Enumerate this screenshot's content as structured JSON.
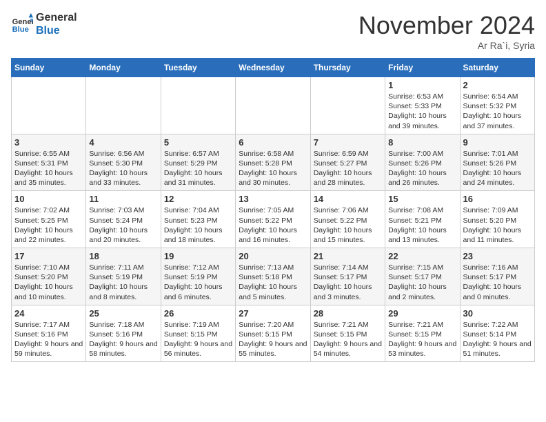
{
  "header": {
    "logo_line1": "General",
    "logo_line2": "Blue",
    "month_title": "November 2024",
    "location": "Ar Ra`i, Syria"
  },
  "weekdays": [
    "Sunday",
    "Monday",
    "Tuesday",
    "Wednesday",
    "Thursday",
    "Friday",
    "Saturday"
  ],
  "weeks": [
    [
      {
        "day": "",
        "info": ""
      },
      {
        "day": "",
        "info": ""
      },
      {
        "day": "",
        "info": ""
      },
      {
        "day": "",
        "info": ""
      },
      {
        "day": "",
        "info": ""
      },
      {
        "day": "1",
        "info": "Sunrise: 6:53 AM\nSunset: 5:33 PM\nDaylight: 10 hours and 39 minutes."
      },
      {
        "day": "2",
        "info": "Sunrise: 6:54 AM\nSunset: 5:32 PM\nDaylight: 10 hours and 37 minutes."
      }
    ],
    [
      {
        "day": "3",
        "info": "Sunrise: 6:55 AM\nSunset: 5:31 PM\nDaylight: 10 hours and 35 minutes."
      },
      {
        "day": "4",
        "info": "Sunrise: 6:56 AM\nSunset: 5:30 PM\nDaylight: 10 hours and 33 minutes."
      },
      {
        "day": "5",
        "info": "Sunrise: 6:57 AM\nSunset: 5:29 PM\nDaylight: 10 hours and 31 minutes."
      },
      {
        "day": "6",
        "info": "Sunrise: 6:58 AM\nSunset: 5:28 PM\nDaylight: 10 hours and 30 minutes."
      },
      {
        "day": "7",
        "info": "Sunrise: 6:59 AM\nSunset: 5:27 PM\nDaylight: 10 hours and 28 minutes."
      },
      {
        "day": "8",
        "info": "Sunrise: 7:00 AM\nSunset: 5:26 PM\nDaylight: 10 hours and 26 minutes."
      },
      {
        "day": "9",
        "info": "Sunrise: 7:01 AM\nSunset: 5:26 PM\nDaylight: 10 hours and 24 minutes."
      }
    ],
    [
      {
        "day": "10",
        "info": "Sunrise: 7:02 AM\nSunset: 5:25 PM\nDaylight: 10 hours and 22 minutes."
      },
      {
        "day": "11",
        "info": "Sunrise: 7:03 AM\nSunset: 5:24 PM\nDaylight: 10 hours and 20 minutes."
      },
      {
        "day": "12",
        "info": "Sunrise: 7:04 AM\nSunset: 5:23 PM\nDaylight: 10 hours and 18 minutes."
      },
      {
        "day": "13",
        "info": "Sunrise: 7:05 AM\nSunset: 5:22 PM\nDaylight: 10 hours and 16 minutes."
      },
      {
        "day": "14",
        "info": "Sunrise: 7:06 AM\nSunset: 5:22 PM\nDaylight: 10 hours and 15 minutes."
      },
      {
        "day": "15",
        "info": "Sunrise: 7:08 AM\nSunset: 5:21 PM\nDaylight: 10 hours and 13 minutes."
      },
      {
        "day": "16",
        "info": "Sunrise: 7:09 AM\nSunset: 5:20 PM\nDaylight: 10 hours and 11 minutes."
      }
    ],
    [
      {
        "day": "17",
        "info": "Sunrise: 7:10 AM\nSunset: 5:20 PM\nDaylight: 10 hours and 10 minutes."
      },
      {
        "day": "18",
        "info": "Sunrise: 7:11 AM\nSunset: 5:19 PM\nDaylight: 10 hours and 8 minutes."
      },
      {
        "day": "19",
        "info": "Sunrise: 7:12 AM\nSunset: 5:19 PM\nDaylight: 10 hours and 6 minutes."
      },
      {
        "day": "20",
        "info": "Sunrise: 7:13 AM\nSunset: 5:18 PM\nDaylight: 10 hours and 5 minutes."
      },
      {
        "day": "21",
        "info": "Sunrise: 7:14 AM\nSunset: 5:17 PM\nDaylight: 10 hours and 3 minutes."
      },
      {
        "day": "22",
        "info": "Sunrise: 7:15 AM\nSunset: 5:17 PM\nDaylight: 10 hours and 2 minutes."
      },
      {
        "day": "23",
        "info": "Sunrise: 7:16 AM\nSunset: 5:17 PM\nDaylight: 10 hours and 0 minutes."
      }
    ],
    [
      {
        "day": "24",
        "info": "Sunrise: 7:17 AM\nSunset: 5:16 PM\nDaylight: 9 hours and 59 minutes."
      },
      {
        "day": "25",
        "info": "Sunrise: 7:18 AM\nSunset: 5:16 PM\nDaylight: 9 hours and 58 minutes."
      },
      {
        "day": "26",
        "info": "Sunrise: 7:19 AM\nSunset: 5:15 PM\nDaylight: 9 hours and 56 minutes."
      },
      {
        "day": "27",
        "info": "Sunrise: 7:20 AM\nSunset: 5:15 PM\nDaylight: 9 hours and 55 minutes."
      },
      {
        "day": "28",
        "info": "Sunrise: 7:21 AM\nSunset: 5:15 PM\nDaylight: 9 hours and 54 minutes."
      },
      {
        "day": "29",
        "info": "Sunrise: 7:21 AM\nSunset: 5:15 PM\nDaylight: 9 hours and 53 minutes."
      },
      {
        "day": "30",
        "info": "Sunrise: 7:22 AM\nSunset: 5:14 PM\nDaylight: 9 hours and 51 minutes."
      }
    ]
  ]
}
